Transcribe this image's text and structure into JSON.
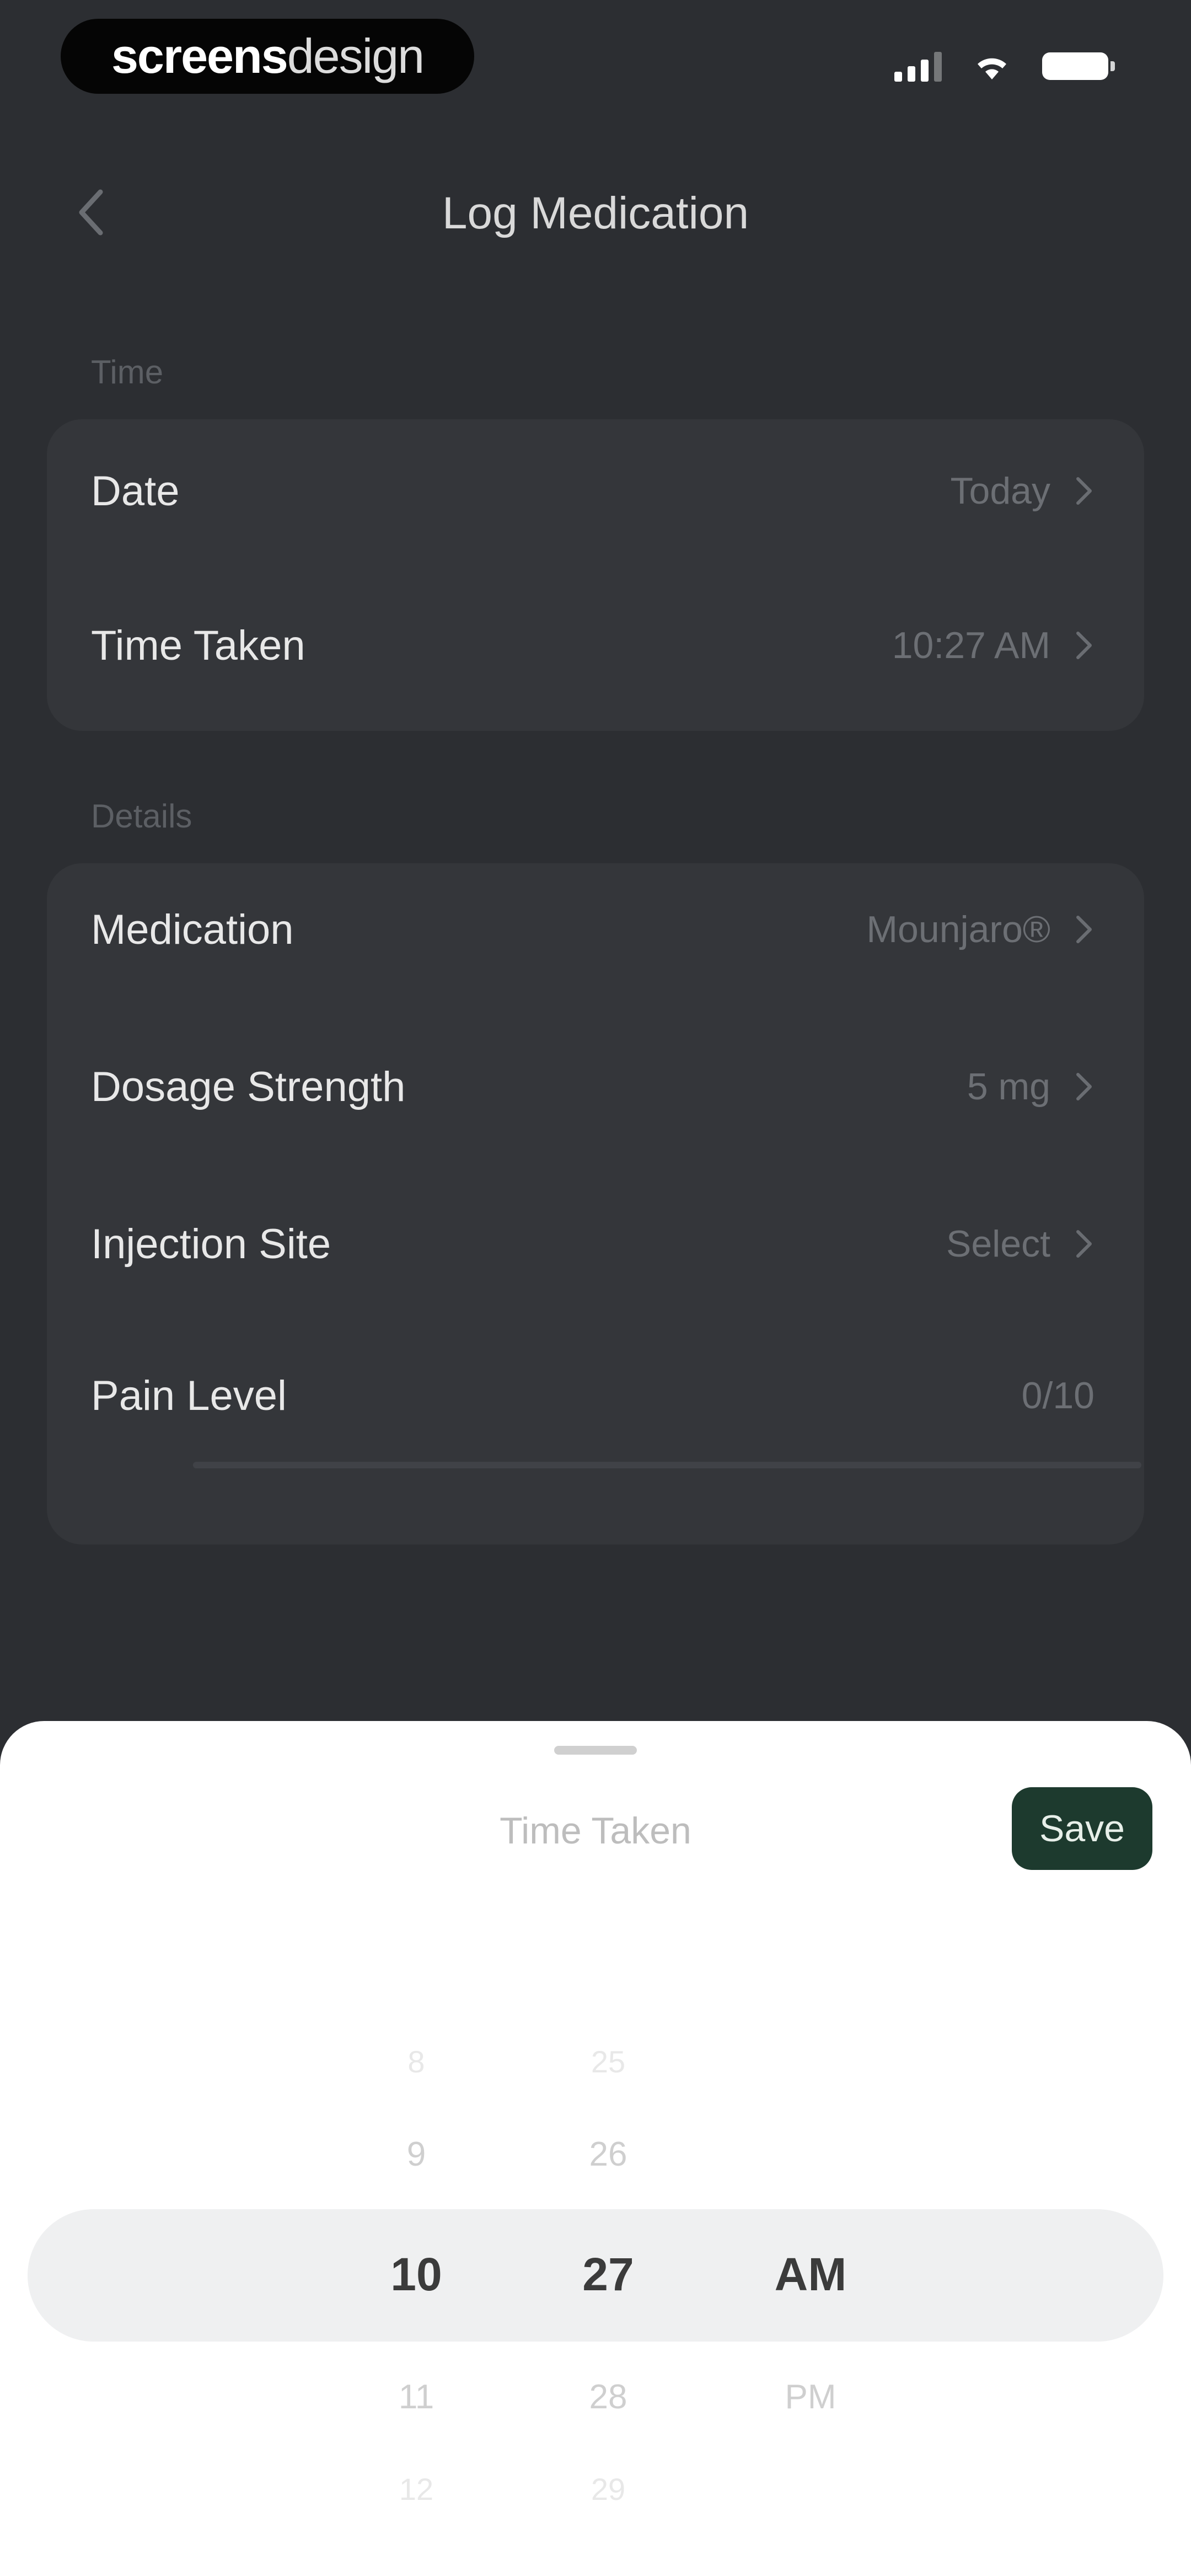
{
  "status_bar": {
    "brand_bold": "screens",
    "brand_light": "design",
    "icons": [
      "signal-icon",
      "wifi-icon",
      "battery-icon"
    ]
  },
  "header": {
    "title": "Log Medication",
    "back_icon": "chevron-left-icon"
  },
  "sections": {
    "time": {
      "label": "Time",
      "rows": [
        {
          "label": "Date",
          "value": "Today"
        },
        {
          "label": "Time Taken",
          "value": "10:27 AM"
        }
      ]
    },
    "details": {
      "label": "Details",
      "rows": [
        {
          "label": "Medication",
          "value": "Mounjaro®"
        },
        {
          "label": "Dosage Strength",
          "value": "5 mg"
        },
        {
          "label": "Injection Site",
          "value": "Select"
        },
        {
          "label": "Pain Level",
          "value": "0/10"
        }
      ]
    }
  },
  "sheet": {
    "title": "Time Taken",
    "save_label": "Save",
    "picker": {
      "hours": [
        "8",
        "9",
        "10",
        "11",
        "12"
      ],
      "minutes": [
        "25",
        "26",
        "27",
        "28",
        "29"
      ],
      "period": [
        "AM",
        "PM"
      ],
      "selected": {
        "hour": "10",
        "minute": "27",
        "period": "AM"
      }
    }
  },
  "colors": {
    "background": "#2c2e32",
    "card": "#34363a",
    "accent_button": "#1d3a2e",
    "sheet": "#ffffff"
  }
}
